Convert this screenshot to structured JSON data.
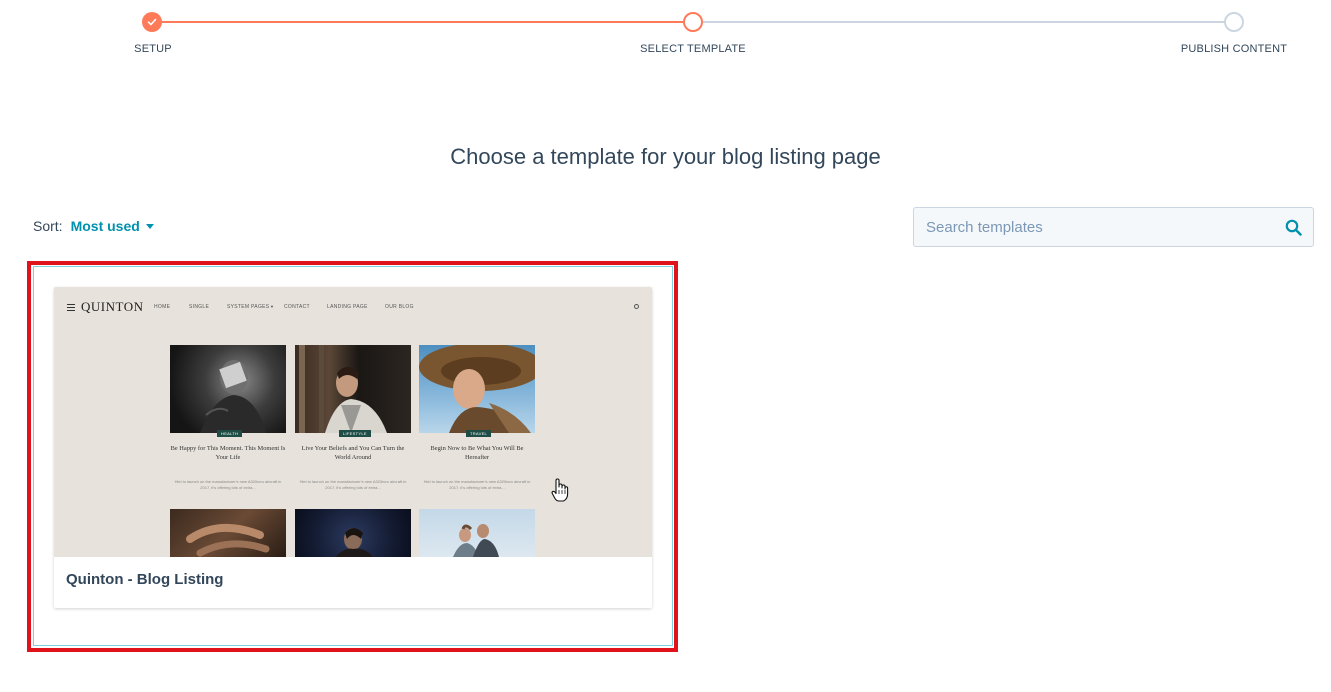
{
  "stepper": {
    "steps": [
      {
        "label": "SETUP",
        "status": "complete"
      },
      {
        "label": "SELECT TEMPLATE",
        "status": "current"
      },
      {
        "label": "PUBLISH CONTENT",
        "status": "upcoming"
      }
    ]
  },
  "page": {
    "title": "Choose a template for your blog listing page"
  },
  "sort": {
    "label": "Sort:",
    "value": "Most used"
  },
  "search": {
    "placeholder": "Search templates"
  },
  "templates": [
    {
      "name": "Quinton - Blog Listing",
      "preview": {
        "logo": "QUINTON",
        "menu": [
          "HOME",
          "SINGLE",
          "SYSTEM PAGES",
          "CONTACT",
          "LANDING PAGE",
          "OUR BLOG"
        ],
        "posts": [
          {
            "tag": "HEALTH",
            "title": "Be Happy for This Moment. This Moment Is Your Life",
            "excerpt": "Hiel to launch on the manufacturer's new A320neo aircraft in 2017, it's offering lots of extra..."
          },
          {
            "tag": "LIFESTYLE",
            "title": "Live Your Beliefs and You Can Turn the World Around",
            "excerpt": "Hiel to launch on the manufacturer's new A320neo aircraft in 2017, it's offering lots of extra..."
          },
          {
            "tag": "TRAVEL",
            "title": "Begin Now to Be What You Will Be Hereafter",
            "excerpt": "Hiel to launch on the manufacturer's new A320neo aircraft in 2017, it's offering lots of extra..."
          }
        ]
      }
    }
  ],
  "colors": {
    "accent": "#ff7a59",
    "link": "#0091ae",
    "text": "#33475b",
    "highlight": "#e0121c"
  }
}
